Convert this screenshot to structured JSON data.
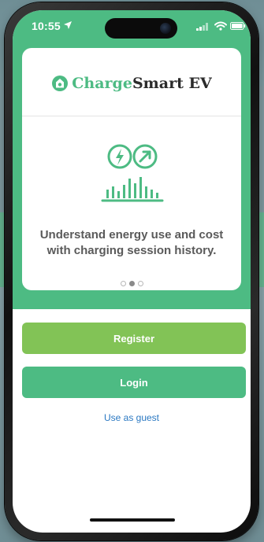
{
  "status_bar": {
    "time": "10:55"
  },
  "brand": {
    "part1": "Charge",
    "part2": "Smart EV"
  },
  "onboarding": {
    "text": "Understand energy use and cost with charging session history.",
    "pagination": {
      "total": 3,
      "active_index": 1
    }
  },
  "actions": {
    "register_label": "Register",
    "login_label": "Login",
    "guest_label": "Use as guest"
  },
  "colors": {
    "primary_green": "#4dbb83",
    "register_green": "#82c356",
    "link_blue": "#2a78c2"
  },
  "icons": {
    "status_location": "location-arrow-icon",
    "status_signal": "signal-icon",
    "status_wifi": "wifi-icon",
    "status_battery": "battery-icon",
    "brand_logo": "plug-logo-icon",
    "feature": "energy-cost-history-icon"
  }
}
